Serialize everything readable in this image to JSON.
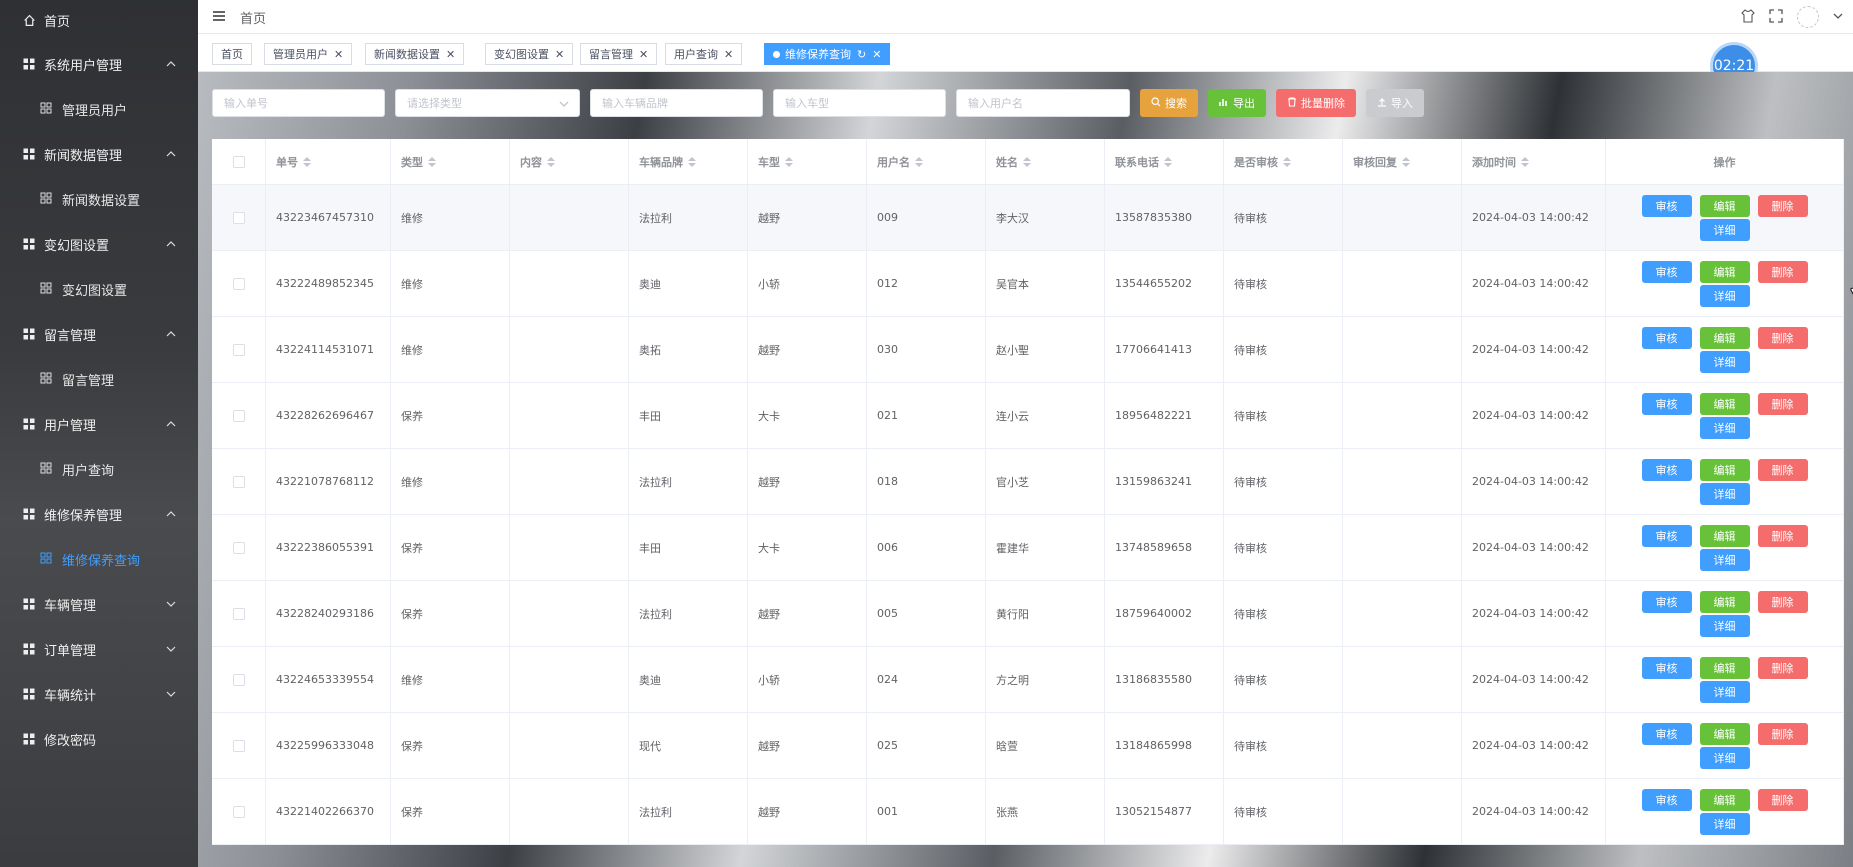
{
  "sidebar": {
    "home": "首页",
    "groups": [
      {
        "label": "系统用户管理",
        "sub": "管理员用户"
      },
      {
        "label": "新闻数据管理",
        "sub": "新闻数据设置"
      },
      {
        "label": "变幻图设置",
        "sub": "变幻图设置"
      },
      {
        "label": "留言管理",
        "sub": "留言管理"
      },
      {
        "label": "用户管理",
        "sub": "用户查询"
      },
      {
        "label": "维修保养管理",
        "sub": "维修保养查询"
      }
    ],
    "collapsed": [
      "车辆管理",
      "订单管理",
      "车辆统计"
    ],
    "last": "修改密码"
  },
  "header": {
    "breadcrumb": "首页"
  },
  "tags": [
    {
      "label": "首页"
    },
    {
      "label": "管理员用户"
    },
    {
      "label": "新闻数据设置"
    },
    {
      "label": "变幻图设置"
    },
    {
      "label": "留言管理"
    },
    {
      "label": "用户查询"
    },
    {
      "label": "维修保养查询",
      "active": true
    }
  ],
  "timer": "02:21",
  "search": {
    "order_no": "输入单号",
    "type": "请选择类型",
    "brand": "输入车辆品牌",
    "model": "输入车型",
    "username": "输入用户名",
    "btn_search": "搜索",
    "btn_export": "导出",
    "btn_batch_delete": "批量删除",
    "btn_import": "导入"
  },
  "table": {
    "headers": [
      "单号",
      "类型",
      "内容",
      "车辆品牌",
      "车型",
      "用户名",
      "姓名",
      "联系电话",
      "是否审核",
      "审核回复",
      "添加时间",
      "操作"
    ],
    "rows": [
      {
        "no": "43223467457310",
        "type": "维修",
        "content": "",
        "brand": "法拉利",
        "model": "越野",
        "user": "009",
        "name": "李大汉",
        "phone": "13587835380",
        "audit": "待审核",
        "reply": "",
        "time": "2024-04-03 14:00:42"
      },
      {
        "no": "43222489852345",
        "type": "维修",
        "content": "",
        "brand": "奥迪",
        "model": "小轿",
        "user": "012",
        "name": "吴官本",
        "phone": "13544655202",
        "audit": "待审核",
        "reply": "",
        "time": "2024-04-03 14:00:42"
      },
      {
        "no": "43224114531071",
        "type": "维修",
        "content": "",
        "brand": "奥拓",
        "model": "越野",
        "user": "030",
        "name": "赵小聖",
        "phone": "17706641413",
        "audit": "待审核",
        "reply": "",
        "time": "2024-04-03 14:00:42"
      },
      {
        "no": "43228262696467",
        "type": "保养",
        "content": "",
        "brand": "丰田",
        "model": "大卡",
        "user": "021",
        "name": "连小云",
        "phone": "18956482221",
        "audit": "待审核",
        "reply": "",
        "time": "2024-04-03 14:00:42"
      },
      {
        "no": "43221078768112",
        "type": "维修",
        "content": "",
        "brand": "法拉利",
        "model": "越野",
        "user": "018",
        "name": "官小芝",
        "phone": "13159863241",
        "audit": "待审核",
        "reply": "",
        "time": "2024-04-03 14:00:42"
      },
      {
        "no": "43222386055391",
        "type": "保养",
        "content": "",
        "brand": "丰田",
        "model": "大卡",
        "user": "006",
        "name": "霍建华",
        "phone": "13748589658",
        "audit": "待审核",
        "reply": "",
        "time": "2024-04-03 14:00:42"
      },
      {
        "no": "43228240293186",
        "type": "保养",
        "content": "",
        "brand": "法拉利",
        "model": "越野",
        "user": "005",
        "name": "黄行阳",
        "phone": "18759640002",
        "audit": "待审核",
        "reply": "",
        "time": "2024-04-03 14:00:42"
      },
      {
        "no": "43224653339554",
        "type": "维修",
        "content": "",
        "brand": "奥迪",
        "model": "小轿",
        "user": "024",
        "name": "方之明",
        "phone": "13186835580",
        "audit": "待审核",
        "reply": "",
        "time": "2024-04-03 14:00:42"
      },
      {
        "no": "43225996333048",
        "type": "保养",
        "content": "",
        "brand": "现代",
        "model": "越野",
        "user": "025",
        "name": "晗萱",
        "phone": "13184865998",
        "audit": "待审核",
        "reply": "",
        "time": "2024-04-03 14:00:42"
      },
      {
        "no": "43221402266370",
        "type": "保养",
        "content": "",
        "brand": "法拉利",
        "model": "越野",
        "user": "001",
        "name": "张燕",
        "phone": "13052154877",
        "audit": "待审核",
        "reply": "",
        "time": "2024-04-03 14:00:42"
      }
    ],
    "ops": {
      "audit": "审核",
      "edit": "编辑",
      "delete": "删除",
      "detail": "详细"
    }
  }
}
